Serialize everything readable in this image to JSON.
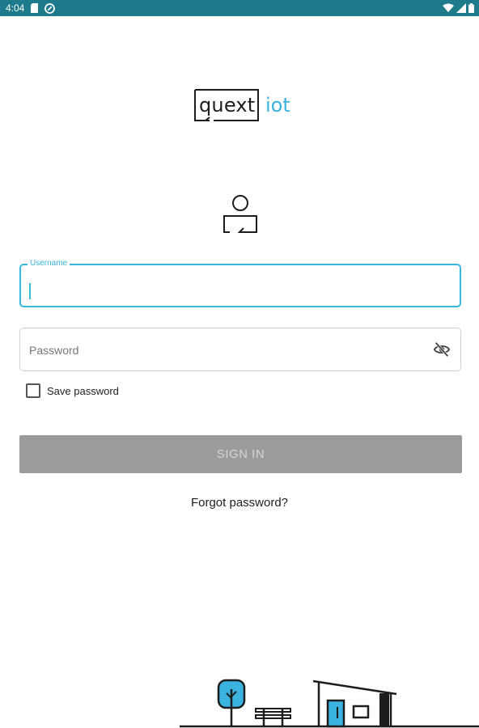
{
  "status_bar": {
    "time": "4:04",
    "background_color": "#1e7b8c",
    "left_icons": [
      "sd-card-icon",
      "do-not-disturb-icon"
    ],
    "right_icons": [
      "wifi-icon",
      "cell-signal-icon",
      "battery-icon"
    ]
  },
  "logo": {
    "word": "quext",
    "suffix": "iot",
    "suffix_color": "#3ab3e1"
  },
  "login_form": {
    "username": {
      "label": "Username",
      "value": "",
      "accent_color": "#39b6dc"
    },
    "password": {
      "placeholder": "Password",
      "value": "",
      "toggle_icon": "visibility-off-icon"
    },
    "save_password": {
      "label": "Save password",
      "checked": false
    },
    "sign_in": {
      "label": "SIGN IN",
      "enabled": false,
      "background_color": "#9b9b9b"
    },
    "forgot_password": {
      "label": "Forgot password?"
    }
  },
  "illustration": {
    "elements": [
      "tree-icon",
      "bench-icon",
      "house-icon"
    ],
    "accent_color": "#3ab3e1"
  }
}
